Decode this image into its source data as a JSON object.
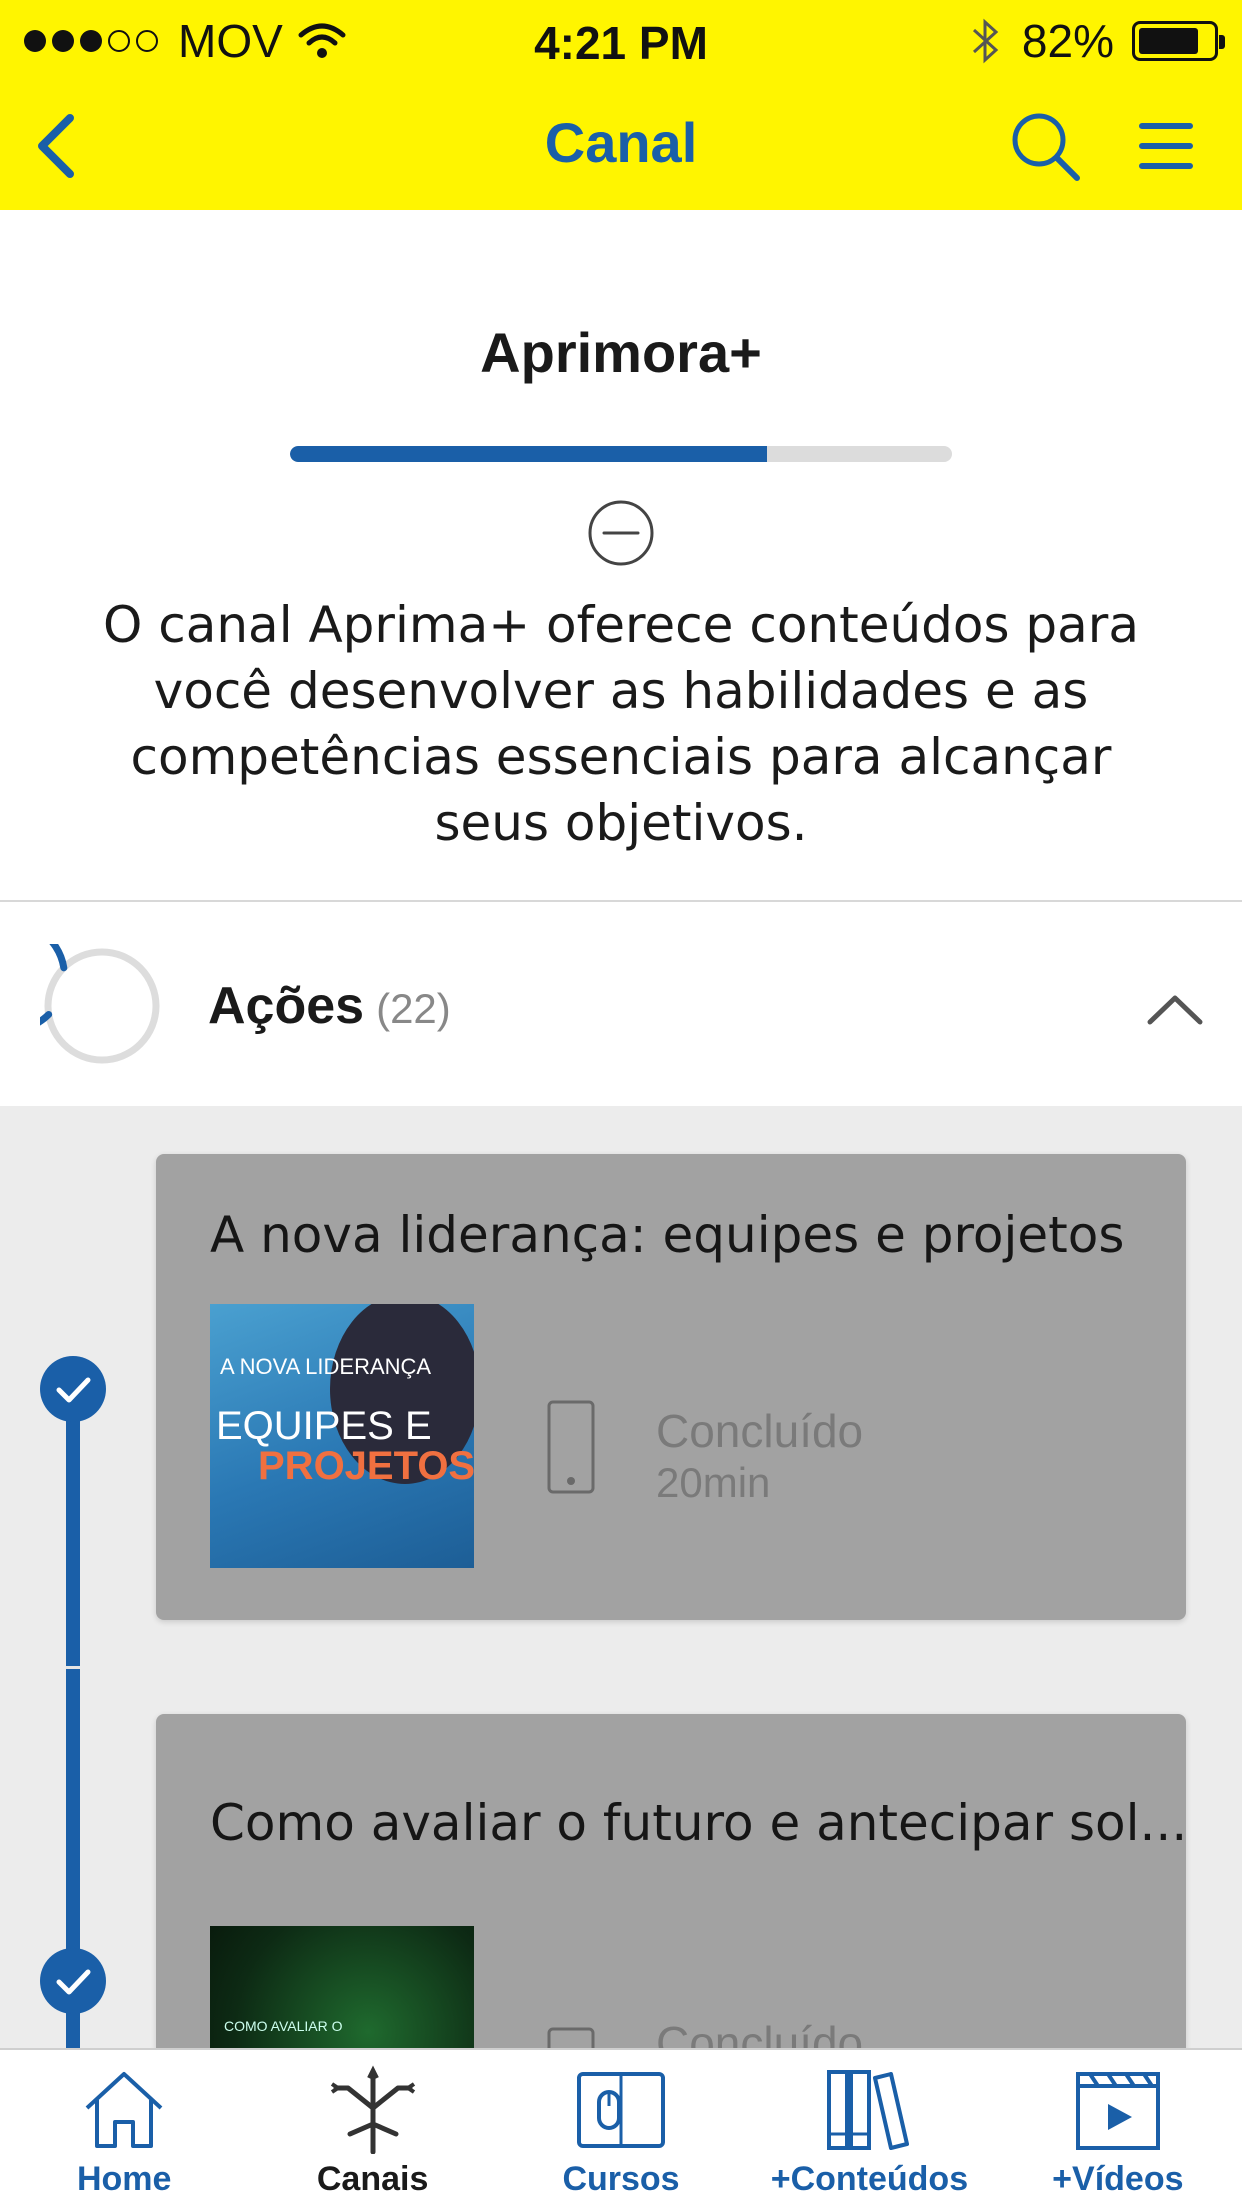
{
  "status_bar": {
    "carrier": "MOV",
    "time": "4:21 PM",
    "battery": "82%",
    "battery_level": 0.82
  },
  "nav": {
    "title": "Canal",
    "back_icon": "chevron-left-icon",
    "search_icon": "search-icon",
    "menu_icon": "hamburger-menu-icon"
  },
  "channel": {
    "title": "Aprimora+",
    "progress_fraction": 0.72,
    "description": "O canal Aprima+ oferece conteúdos para você desenvolver as habilidades e as competências essenciais para alcançar seus objetivos."
  },
  "actions": {
    "label": "Ações",
    "count": "(22)"
  },
  "cards": [
    {
      "title": "A nova liderança: equipes e projetos",
      "thumb_small": "A NOVA LIDERANÇA",
      "thumb_line1": "EQUIPES E",
      "thumb_line2": "PROJETOS",
      "status": "Concluído",
      "duration": "20min"
    },
    {
      "title": "Como avaliar o futuro e antecipar sol...",
      "thumb_small": "COMO AVALIAR O",
      "status": "Concluído"
    }
  ],
  "tabs": [
    {
      "label": "Home",
      "icon": "home-icon"
    },
    {
      "label": "Canais",
      "icon": "channels-icon"
    },
    {
      "label": "Cursos",
      "icon": "courses-icon"
    },
    {
      "label": "+Conteúdos",
      "icon": "books-icon"
    },
    {
      "label": "+Vídeos",
      "icon": "video-icon"
    }
  ],
  "colors": {
    "topbar": "#fff500",
    "accent": "#1a5fa8",
    "card": "#a2a2a2"
  }
}
